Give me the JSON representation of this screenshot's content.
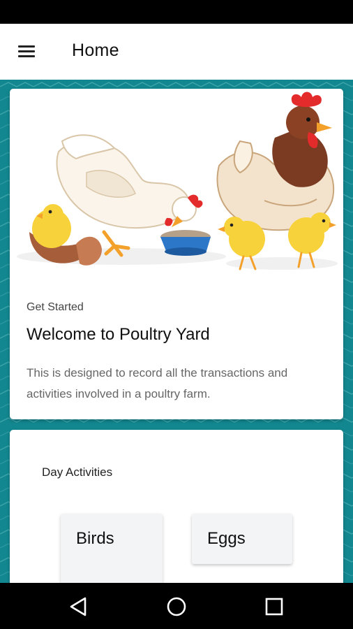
{
  "app_bar": {
    "title": "Home",
    "menu_icon": "hamburger-menu-icon"
  },
  "welcome_card": {
    "image": "poultry-illustration",
    "eyebrow": "Get Started",
    "title": "Welcome to Poultry Yard",
    "description": "This is designed to record all the transactions and activities involved in a poultry farm."
  },
  "activities_card": {
    "title": "Day Activities",
    "tiles": [
      {
        "label": "Birds"
      },
      {
        "label": "Eggs"
      }
    ]
  },
  "nav_bar": {
    "back_icon": "back-triangle-icon",
    "home_icon": "home-circle-icon",
    "recents_icon": "recents-square-icon"
  },
  "colors": {
    "background": "#13878f",
    "card": "#ffffff",
    "tile": "#f3f4f6"
  }
}
